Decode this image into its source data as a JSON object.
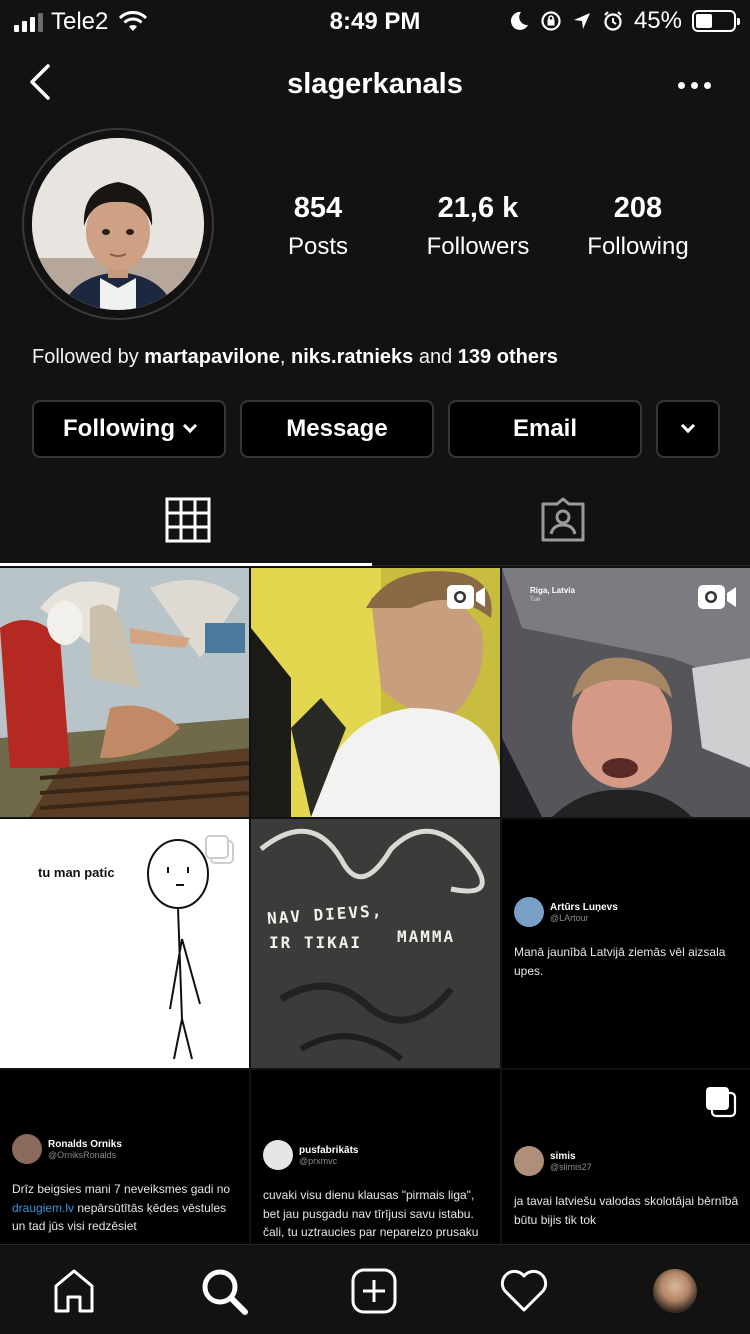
{
  "status_bar": {
    "carrier": "Tele2",
    "time": "8:49 PM",
    "battery": "45%",
    "battery_level": 0.45
  },
  "header": {
    "username": "slagerkanals"
  },
  "profile": {
    "stats": [
      {
        "value": "854",
        "label": "Posts"
      },
      {
        "value": "21,6 k",
        "label": "Followers"
      },
      {
        "value": "208",
        "label": "Following"
      }
    ],
    "followed_by": {
      "prefix": "Followed by ",
      "user1": "martapavilone",
      "sep": ", ",
      "user2": "niks.ratnieks",
      "mid": " and ",
      "others": "139 others"
    }
  },
  "actions": {
    "following": "Following",
    "message": "Message",
    "email": "Email"
  },
  "grid": {
    "meme_text": "tu man patic",
    "graffiti_line1": "NAV DIEVS,",
    "graffiti_line2": "IR TIKAI",
    "graffiti_line3": "MAMMA",
    "story_location": "Riga, Latvia",
    "story_day": "Tue",
    "tweets": [
      {
        "name": "Artūrs Luņevs",
        "handle": "@LArtour",
        "text": "Manā jaunībā Latvijā ziemās vēl aizsala upes."
      },
      {
        "name": "Ronalds Orniks",
        "handle": "@OrniksRonalds",
        "text_before": "Drīz beigsies mani 7 neveiksmes gadi no ",
        "link": "draugiem.lv",
        "text_after": " nepārsūtītās ķēdes vēstules un tad jūs visi redzēsiet"
      },
      {
        "name": "pusfabrikāts",
        "handle": "@prxmvc",
        "text": "cuvaki visu dienu klausas \"pirmais liga\", bet jau pusgadu nav tīrījusi savu istabu. čali, tu uztraucies par nepareizo prusaku"
      },
      {
        "name": "simis",
        "handle": "@slimis27",
        "text": "ja tavai latviešu valodas skolotājai bērnībā būtu bijis tik tok"
      }
    ]
  },
  "colors": {
    "background": "#121212",
    "border": "#363636",
    "link": "#3b94d9"
  },
  "icons": [
    "back-arrow-icon",
    "more-icon",
    "grid-icon",
    "tagged-icon",
    "igtv-icon",
    "carousel-icon",
    "home-icon",
    "search-icon",
    "add-post-icon",
    "heart-icon"
  ]
}
